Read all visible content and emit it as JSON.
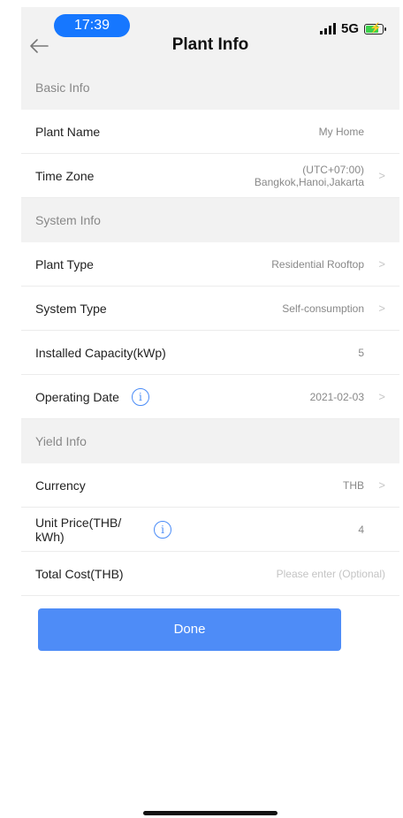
{
  "status_bar": {
    "time": "17:39",
    "network": "5G"
  },
  "header": {
    "title": "Plant Info"
  },
  "sections": {
    "basic": "Basic Info",
    "system": "System Info",
    "yield": "Yield Info"
  },
  "rows": {
    "plant_name": {
      "label": "Plant Name",
      "value": "My Home"
    },
    "time_zone": {
      "label": "Time Zone",
      "value_line1": "(UTC+07:00)",
      "value_line2": "Bangkok,Hanoi,Jakarta"
    },
    "plant_type": {
      "label": "Plant Type",
      "value": "Residential Rooftop"
    },
    "system_type": {
      "label": "System Type",
      "value": "Self-consumption"
    },
    "installed_capacity": {
      "label": "Installed Capacity(kWp)",
      "value": "5"
    },
    "operating_date": {
      "label": "Operating Date",
      "value": "2021-02-03"
    },
    "currency": {
      "label": "Currency",
      "value": "THB"
    },
    "unit_price": {
      "label": "Unit Price(THB/ kWh)",
      "value": "4"
    },
    "total_cost": {
      "label": "Total Cost(THB)",
      "placeholder": "Please enter (Optional)"
    }
  },
  "buttons": {
    "done": "Done"
  },
  "icons": {
    "chevron": ">",
    "info": "i",
    "battery_bolt": "⚡"
  },
  "colors": {
    "accent": "#4e8cf7",
    "time_pill": "#1677ff",
    "battery": "#3cd14b"
  }
}
